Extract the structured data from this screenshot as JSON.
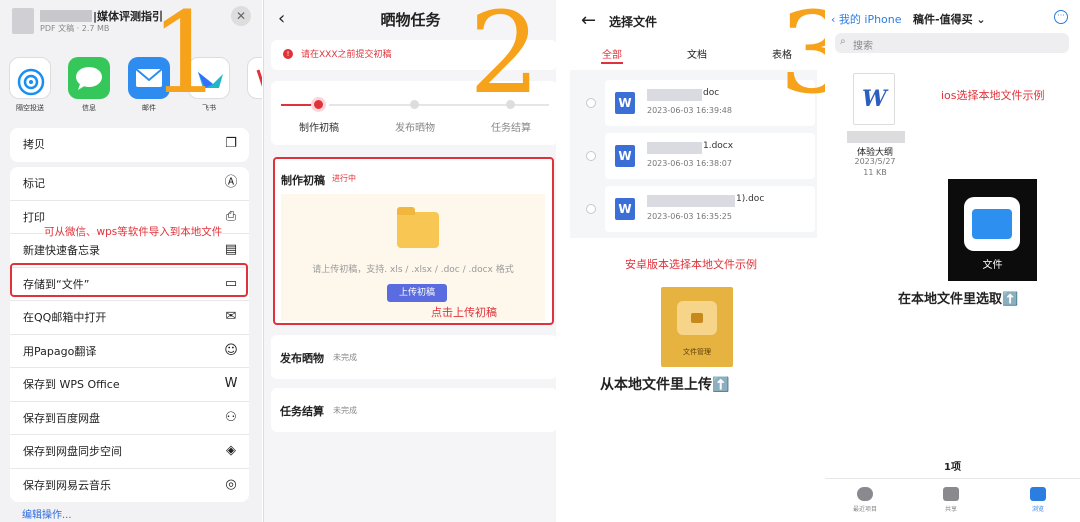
{
  "panel1": {
    "file_title": "|媒体评测指引",
    "file_meta": "PDF 文稿 · 2.7 MB",
    "close_glyph": "✕",
    "big_number": "1",
    "apps": [
      {
        "label": "隔空投送",
        "icon": "airdrop-icon",
        "color": "#1a8ff3"
      },
      {
        "label": "信息",
        "icon": "messages-icon",
        "color": "#35c759"
      },
      {
        "label": "邮件",
        "icon": "mail-icon",
        "color": "#2e8cf0"
      },
      {
        "label": "飞书",
        "icon": "feishu-icon",
        "color": "#ffffff"
      },
      {
        "label": "WP",
        "icon": "wps-icon",
        "color": "#ffffff"
      }
    ],
    "group1": [
      {
        "label": "拷贝",
        "icon": "copy-icon",
        "glyph": "❐"
      }
    ],
    "group2": [
      {
        "label": "标记",
        "icon": "markup-icon",
        "glyph": "Ⓐ"
      },
      {
        "label": "打印",
        "icon": "print-icon",
        "glyph": "⎙"
      },
      {
        "label": "新建快速备忘录",
        "icon": "quick-note-icon",
        "glyph": "▤"
      },
      {
        "label": "存储到“文件”",
        "icon": "folder-icon",
        "glyph": "▭"
      },
      {
        "label": "在QQ邮箱中打开",
        "icon": "mail-outline-icon",
        "glyph": "✉"
      },
      {
        "label": "用Papago翻译",
        "icon": "papago-icon",
        "glyph": "☺"
      },
      {
        "label": "保存到 WPS Office",
        "icon": "wps-outline-icon",
        "glyph": "W"
      },
      {
        "label": "保存到百度网盘",
        "icon": "baidu-pan-icon",
        "glyph": "⚇"
      },
      {
        "label": "保存到网盘同步空间",
        "icon": "sync-space-icon",
        "glyph": "◈"
      },
      {
        "label": "保存到网易云音乐",
        "icon": "netease-music-icon",
        "glyph": "◎"
      }
    ],
    "annotation": "可从微信、wps等软件导入到本地文件",
    "edit_actions": "编辑操作..."
  },
  "panel2": {
    "big_number": "2",
    "back_glyph": "‹",
    "title": "晒物任务",
    "notice_glyph": "!",
    "notice": "请在XXX之前提交初稿",
    "steps": [
      "制作初稿",
      "发布晒物",
      "任务结算"
    ],
    "active_step": 0,
    "task_title": "制作初稿",
    "task_status": "进行中",
    "upload_hint": "请上传初稿，支持. xls / .xlsx / .doc / .docx 格式",
    "upload_button": "上传初稿",
    "click_annotation": "点击上传初稿",
    "sections": [
      {
        "title": "发布晒物",
        "status": "未完成"
      },
      {
        "title": "任务结算",
        "status": "未完成"
      }
    ],
    "accent": "#e0323a"
  },
  "panel3": {
    "big_number": "3",
    "back_glyph": "←",
    "title": "选择文件",
    "tabs": [
      "全部",
      "文档",
      "表格"
    ],
    "files": [
      {
        "suffix": "doc",
        "date": "2023-06-03 16:39:48",
        "icon_glyph": "W"
      },
      {
        "suffix": "1.docx",
        "date": "2023-06-03 16:38:07",
        "icon_glyph": "W"
      },
      {
        "suffix": "1).doc",
        "date": "2023-06-03 16:35:25",
        "icon_glyph": "W"
      }
    ],
    "android_annotation": "安卓版本选择本地文件示例",
    "file_manager_label": "文件管理",
    "upload_from_local": "从本地文件里上传⬆️"
  },
  "panel4": {
    "back_label": "‹ 我的 iPhone",
    "folder_title": "稿件-值得买 ⌄",
    "more_glyph": "···",
    "search_glyph": "⌕",
    "search_placeholder": "搜索",
    "doc_glyph": "W",
    "doc_name": "体验大纲",
    "doc_date": "2023/5/27",
    "doc_size": "11 KB",
    "ios_annotation": "ios选择本地文件示例",
    "files_app_label": "文件",
    "pick_from_local": "在本地文件里选取⬆️",
    "item_count": "1项",
    "tabs": [
      "最近项目",
      "共享",
      "浏览"
    ]
  }
}
